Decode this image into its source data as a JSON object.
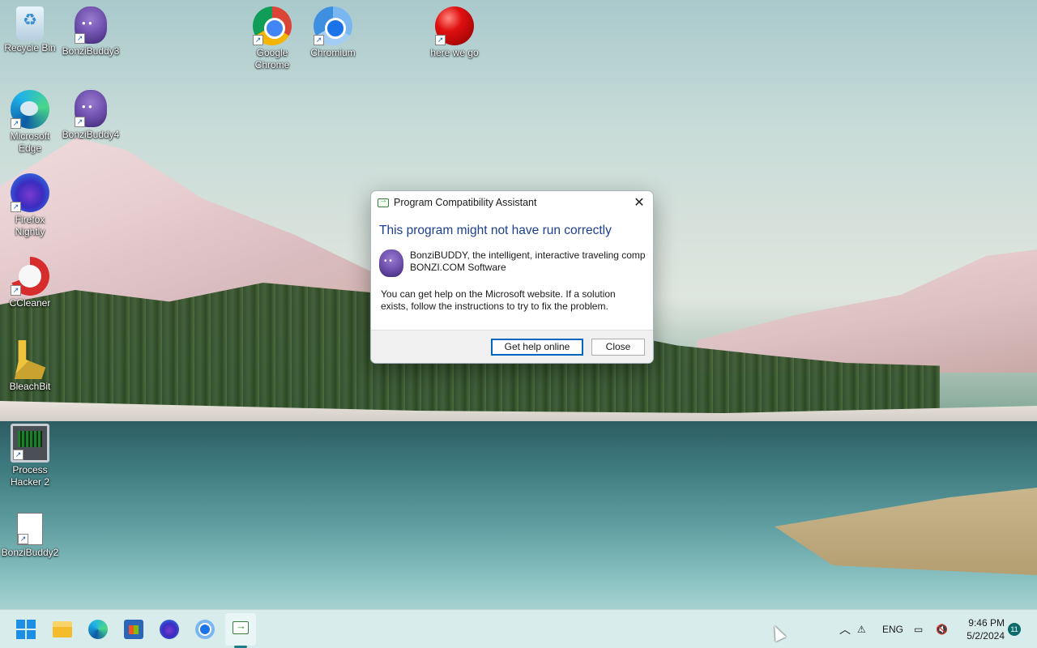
{
  "desktop": {
    "icons": [
      {
        "label": "Recycle Bin",
        "icon": "recycle-bin-icon"
      },
      {
        "label": "BonziBuddy3",
        "icon": "bonzibuddy-icon"
      },
      {
        "label": "Google Chrome",
        "icon": "chrome-icon"
      },
      {
        "label": "Chromium",
        "icon": "chromium-icon"
      },
      {
        "label": "here we go",
        "icon": "red-ball-icon"
      },
      {
        "label": "Microsoft Edge",
        "icon": "edge-icon"
      },
      {
        "label": "BonziBuddy4",
        "icon": "bonzibuddy-icon"
      },
      {
        "label": "Firefox Nightly",
        "icon": "firefox-icon"
      },
      {
        "label": "CCleaner",
        "icon": "ccleaner-icon"
      },
      {
        "label": "BleachBit",
        "icon": "bleachbit-icon"
      },
      {
        "label": "Process Hacker 2",
        "icon": "process-hacker-icon"
      },
      {
        "label": "BonziBuddy2",
        "icon": "document-icon"
      }
    ]
  },
  "dialog": {
    "title": "Program Compatibility Assistant",
    "headline": "This program might not have run correctly",
    "program_name": "BonziBUDDY, the intelligent, interactive traveling comp",
    "program_publisher": "BONZI.COM Software",
    "help_line1": "You can get help on the Microsoft website.  If a solution",
    "help_line2": "exists, follow the instructions to try to fix the problem.",
    "buttons": {
      "get_help": "Get help online",
      "close": "Close"
    }
  },
  "taskbar": {
    "pinned": [
      "start-icon",
      "file-explorer-icon",
      "edge-icon",
      "store-icon",
      "firefox-icon",
      "chromium-icon",
      "compatibility-assistant-icon"
    ],
    "tray": {
      "language": "ENG",
      "time": "9:46 PM",
      "date": "5/2/2024",
      "notifications": "11"
    }
  }
}
